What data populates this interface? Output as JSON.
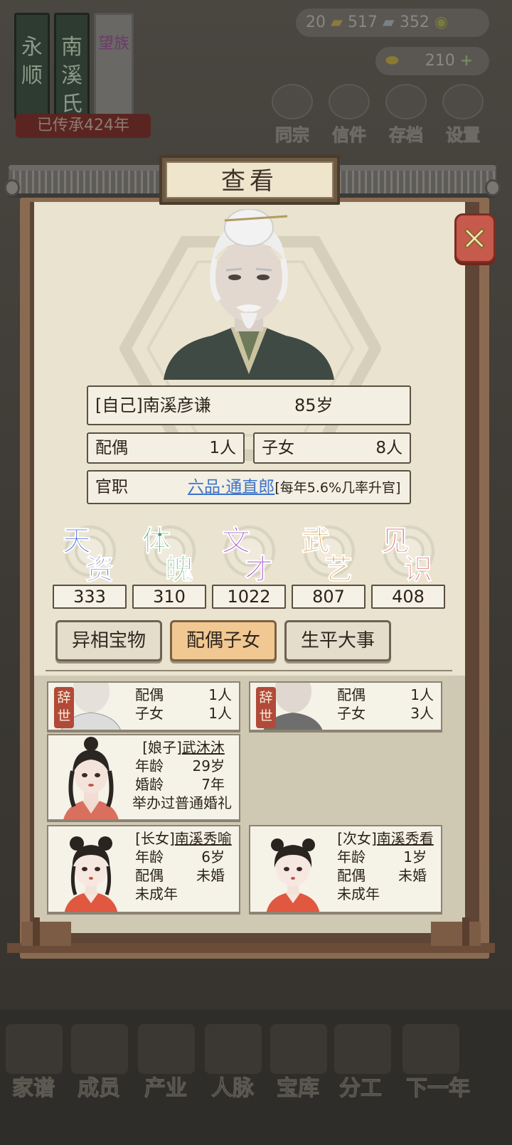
{
  "background": {
    "clan_scroll_1": "永顺",
    "clan_scroll_2": "南溪氏",
    "clan_scroll_3": "望族",
    "inheritance": "已传承424年",
    "currency": {
      "coins": "20",
      "ingots": "517",
      "copper": "352",
      "gold": "210"
    },
    "top_buttons": [
      "同宗",
      "信件",
      "存档",
      "设置"
    ],
    "bottom_nav": [
      "家谱",
      "成员",
      "产业",
      "人脉",
      "宝库",
      "分工",
      "下一年"
    ]
  },
  "modal": {
    "title": "查看",
    "close_icon": "close-x-icon",
    "self": {
      "name_label": "[自己]南溪彦谦",
      "age": "85岁"
    },
    "spouse": {
      "label": "配偶",
      "value": "1人"
    },
    "children": {
      "label": "子女",
      "value": "8人"
    },
    "official": {
      "label": "官职",
      "rank_link": "六品·通直郎",
      "note": "[每年5.6%几率升官]"
    },
    "attributes": [
      {
        "c1": "天",
        "c2": "资",
        "value": "333",
        "color": "#3c5fd6"
      },
      {
        "c1": "体",
        "c2": "魄",
        "value": "310",
        "color": "#2e9c5a"
      },
      {
        "c1": "文",
        "c2": "才",
        "value": "1022",
        "color": "#9a3cc4"
      },
      {
        "c1": "武",
        "c2": "艺",
        "value": "807",
        "color": "#d68a1e"
      },
      {
        "c1": "见",
        "c2": "识",
        "value": "408",
        "color": "#d24a4a"
      }
    ],
    "tabs": [
      "异相宝物",
      "配偶子女",
      "生平大事"
    ],
    "active_tab": "配偶子女",
    "cards": {
      "top_left": {
        "badge": "辞世",
        "l1k": "配偶",
        "l1v": "1人",
        "l2k": "子女",
        "l2v": "1人"
      },
      "top_right": {
        "badge": "辞世",
        "l1k": "配偶",
        "l1v": "1人",
        "l2k": "子女",
        "l2v": "3人"
      },
      "wife": {
        "tag": "[娘子]",
        "name": "武沐沐",
        "age_k": "年龄",
        "age_v": "29岁",
        "marriage_k": "婚龄",
        "marriage_v": "7年",
        "note": "举办过普通婚礼"
      },
      "daughter1": {
        "tag": "[长女]",
        "name": "南溪秀喻",
        "age_k": "年龄",
        "age_v": "6岁",
        "spouse_k": "配偶",
        "spouse_v": "未婚",
        "note": "未成年"
      },
      "daughter2": {
        "tag": "[次女]",
        "name": "南溪秀看",
        "age_k": "年龄",
        "age_v": "1岁",
        "spouse_k": "配偶",
        "spouse_v": "未婚",
        "note": "未成年"
      }
    }
  }
}
